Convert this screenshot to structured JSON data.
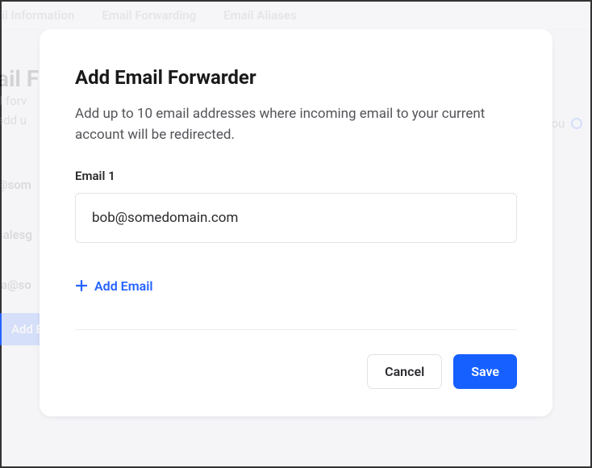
{
  "background": {
    "tabs": [
      "il Information",
      "Email Forwarding",
      "Email Aliases"
    ],
    "title": "ail F",
    "sub1": "il forv",
    "sub2": "add u",
    "emails": [
      "@som",
      "salesg",
      "ta@so"
    ],
    "side_text": "You",
    "add_button_label": "Add E"
  },
  "modal": {
    "title": "Add Email Forwarder",
    "description": "Add up to 10 email addresses where incoming email to your current account will be redirected.",
    "email_field_label": "Email 1",
    "email_value": "bob@somedomain.com",
    "add_email_label": "Add Email",
    "cancel_label": "Cancel",
    "save_label": "Save"
  }
}
